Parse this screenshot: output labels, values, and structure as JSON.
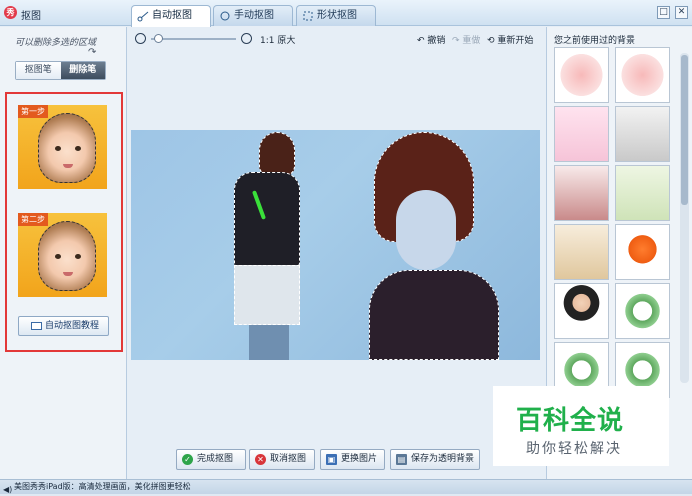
{
  "window": {
    "title": "抠图",
    "app_icon": "秀"
  },
  "tabs": [
    {
      "label": "自动抠图",
      "icon": "scissors-icon"
    },
    {
      "label": "手动抠图",
      "icon": "gear-scissors-icon"
    },
    {
      "label": "形状抠图",
      "icon": "shape-icon"
    }
  ],
  "left": {
    "hint": "可以删除多选的区域",
    "pen_keep": "抠图笔",
    "pen_delete": "删除笔",
    "step1": "第一步",
    "step2": "第二步",
    "tutorial": "自动抠图教程"
  },
  "toolbar": {
    "ratio": "1:1 原大",
    "undo": "撤销",
    "redo": "重做",
    "restart": "重新开始"
  },
  "actions": {
    "done": "完成抠图",
    "cancel": "取消抠图",
    "replace": "更换图片",
    "save_bg": "保存为透明背景"
  },
  "right": {
    "title": "您之前使用过的背景"
  },
  "watermark": {
    "line1": "百科全说",
    "line2": "助你轻松解决"
  },
  "status": "美图秀秀iPad版：高清处理画面，美化拼图更轻松",
  "colors": {
    "accent": "#e23838",
    "green": "#20b04b"
  }
}
